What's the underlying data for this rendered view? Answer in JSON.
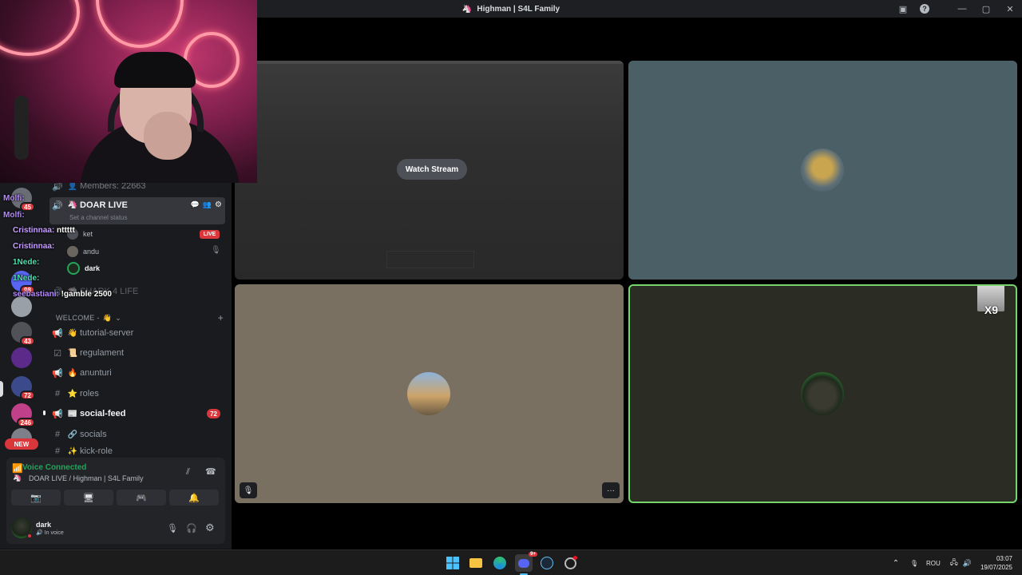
{
  "window": {
    "title": "Highman | S4L Family",
    "icons": [
      "inbox-icon",
      "help-icon",
      "minimize-icon",
      "maximize-icon",
      "close-icon"
    ]
  },
  "chat_overlay": [
    {
      "user": "Molfi:",
      "text": "",
      "color": "#b689ff"
    },
    {
      "user": "Molfi:",
      "text": "",
      "color": "#b689ff"
    },
    {
      "user": "Cristinnaa:",
      "text": "nttttt",
      "color": "#c7a0ff"
    },
    {
      "user": "Cristinnaa:",
      "text": "",
      "color": "#c7a0ff"
    },
    {
      "user": "1Nede:",
      "text": "",
      "color": "#4de0a8"
    },
    {
      "user": "1Nede:",
      "text": "",
      "color": "#4de0a8"
    },
    {
      "user": "seebastiani:",
      "text": "!gamble 2500",
      "color": "#b689ff"
    }
  ],
  "servers": [
    {
      "badge": "45"
    },
    {
      "badge": "98"
    },
    {
      "badge": ""
    },
    {
      "badge": "43"
    },
    {
      "badge": ""
    },
    {
      "badge": "72"
    },
    {
      "badge": "246"
    }
  ],
  "new_badge": "NEW",
  "channels": {
    "members_label": "Members: 22663",
    "active_voice": {
      "name": "DOAR LIVE",
      "status": "Set a channel status"
    },
    "voice_users": [
      {
        "name": "ket",
        "live": "LIVE"
      },
      {
        "name": "andu",
        "live": ""
      },
      {
        "name": "dark",
        "live": ""
      }
    ],
    "shark_channel": "SHARK 4 LIFE",
    "category": "WELCOME -",
    "category_emoji": "👋",
    "list": [
      {
        "icon": "📢",
        "emoji": "👋",
        "name": "tutorial-server",
        "bold": false,
        "count": ""
      },
      {
        "icon": "☑",
        "emoji": "📜",
        "name": "regulament",
        "bold": false,
        "count": ""
      },
      {
        "icon": "📢",
        "emoji": "🔥",
        "name": "anunturi",
        "bold": false,
        "count": ""
      },
      {
        "icon": "#",
        "emoji": "⭐",
        "name": "roles",
        "bold": false,
        "count": ""
      },
      {
        "icon": "📢",
        "emoji": "📰",
        "name": "social-feed",
        "bold": true,
        "count": "72"
      },
      {
        "icon": "#",
        "emoji": "🔗",
        "name": "socials",
        "bold": false,
        "count": ""
      },
      {
        "icon": "#",
        "emoji": "✨",
        "name": "kick-role",
        "bold": false,
        "count": ""
      }
    ]
  },
  "voice_panel": {
    "status": "Voice Connected",
    "location": "DOAR LIVE / Highman | S4L Family",
    "user_name": "dark",
    "user_status": "In voice"
  },
  "stage": {
    "watch_label": "Watch Stream",
    "more_label": "···",
    "corner_tag": "X9"
  },
  "taskbar": {
    "apps": [
      "windows-start-icon",
      "file-explorer-icon",
      "edge-icon",
      "discord-icon",
      "steam-icon",
      "game-bar-icon"
    ],
    "discord_badge": "9+",
    "lang": "ROU",
    "time": "03:07",
    "date": "19/07/2025"
  },
  "colors": {
    "accent_green": "#23a55a",
    "badge_red": "#da373c",
    "tile_blue": "#4b5f67",
    "tile_tan": "#7a7062",
    "tile_olive": "#2b2d24",
    "speaking_outline": "#75d66e"
  }
}
